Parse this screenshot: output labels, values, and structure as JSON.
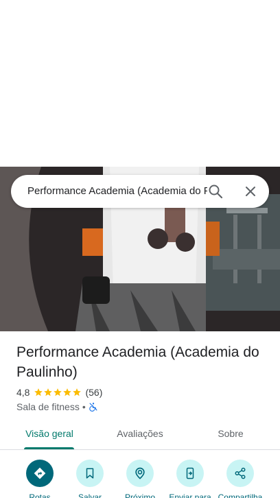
{
  "search": {
    "query": "Performance Academia (Academia do Paulinho)",
    "search_icon": "search-icon",
    "clear_icon": "close-icon"
  },
  "place": {
    "name": "Performance Academia (Academia do Paulinho)",
    "rating": "4,8",
    "stars": 5,
    "reviews_count": "(56)",
    "category": "Sala de fitness",
    "separator": "•",
    "accessibility_icon": "no-wheelchair-access-icon"
  },
  "tabs": [
    {
      "label": "Visão geral",
      "active": true
    },
    {
      "label": "Avaliações",
      "active": false
    },
    {
      "label": "Sobre",
      "active": false
    }
  ],
  "actions": [
    {
      "label": "Rotas",
      "icon": "directions-icon"
    },
    {
      "label": "Salvar",
      "icon": "bookmark-icon"
    },
    {
      "label": "Próximo",
      "icon": "nearby-icon"
    },
    {
      "label": "Enviar para",
      "icon": "send-to-phone-icon"
    },
    {
      "label": "Compartilha",
      "icon": "share-icon"
    }
  ],
  "colors": {
    "accent": "#00796b",
    "action_primary": "#00687a",
    "action_bg": "#c8f4f4",
    "star": "#fbbc04"
  }
}
